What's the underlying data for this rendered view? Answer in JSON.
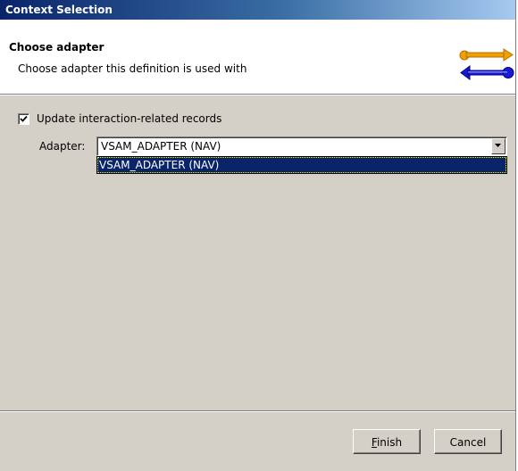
{
  "window": {
    "title": "Context Selection"
  },
  "banner": {
    "title": "Choose adapter",
    "description": "Choose adapter this definition is used with",
    "icon": "adapter-connector-icon"
  },
  "options": {
    "update_records": {
      "label": "Update interaction-related records",
      "checked": true
    }
  },
  "adapter": {
    "label": "Adapter:",
    "selected": "VSAM_ADAPTER (NAV)",
    "options": [
      "VSAM_ADAPTER (NAV)"
    ]
  },
  "buttons": {
    "finish_mnemonic": "F",
    "finish_rest": "inish",
    "cancel": "Cancel"
  },
  "colors": {
    "titlebar": "#0a246a",
    "selection": "#0a246a",
    "face": "#d4d0c8",
    "icon_orange": "#f0a000",
    "icon_blue": "#1a1ad0"
  }
}
